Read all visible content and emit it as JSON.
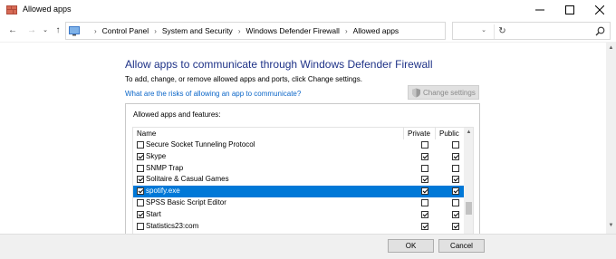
{
  "window": {
    "title": "Allowed apps",
    "minimize_icon": "minimize-icon",
    "maximize_icon": "maximize-icon",
    "close_icon": "close-icon"
  },
  "address": {
    "breadcrumb": [
      "Control Panel",
      "System and Security",
      "Windows Defender Firewall",
      "Allowed apps"
    ],
    "search_placeholder": ""
  },
  "main": {
    "title": "Allow apps to communicate through Windows Defender Firewall",
    "intro": "To add, change, or remove allowed apps and ports, click Change settings.",
    "risks_link": "What are the risks of allowing an app to communicate?",
    "change_settings": "Change settings",
    "group_label": "Allowed apps and features:",
    "columns": {
      "name": "Name",
      "private": "Private",
      "public": "Public"
    },
    "rows": [
      {
        "name": "Secure Socket Tunneling Protocol",
        "enabled": false,
        "private": false,
        "public": false,
        "selected": false
      },
      {
        "name": "Skype",
        "enabled": true,
        "private": true,
        "public": true,
        "selected": false
      },
      {
        "name": "SNMP Trap",
        "enabled": false,
        "private": false,
        "public": false,
        "selected": false
      },
      {
        "name": "Solitaire & Casual Games",
        "enabled": true,
        "private": true,
        "public": true,
        "selected": false
      },
      {
        "name": "spotify.exe",
        "enabled": true,
        "private": true,
        "public": true,
        "selected": true
      },
      {
        "name": "SPSS Basic Script Editor",
        "enabled": false,
        "private": false,
        "public": false,
        "selected": false
      },
      {
        "name": "Start",
        "enabled": true,
        "private": true,
        "public": true,
        "selected": false
      },
      {
        "name": "Statistics23:com",
        "enabled": false,
        "private": true,
        "public": true,
        "selected": false
      }
    ]
  },
  "footer": {
    "ok": "OK",
    "cancel": "Cancel"
  },
  "colors": {
    "accent": "#0078d7",
    "title": "#1e3287",
    "link": "#0b66c8"
  }
}
